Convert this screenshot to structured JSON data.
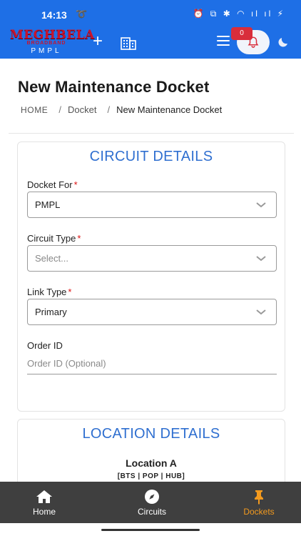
{
  "status_bar": {
    "time": "14:13",
    "indicators": "⏰ ⧉ ✱ ◠ ıl ıl ⚡"
  },
  "app_bar": {
    "logo_line1": "MEGHBELA",
    "logo_line2": "BROADBAND",
    "logo_line3": "PMPL",
    "notification_count": "0",
    "accent_color": "#1e6fe6"
  },
  "page": {
    "title": "New Maintenance Docket",
    "breadcrumb": {
      "home": "HOME",
      "separator": "/",
      "docket": "Docket",
      "current": "New Maintenance Docket"
    }
  },
  "circuit_details": {
    "title": "CIRCUIT DETAILS",
    "docket_for": {
      "label": "Docket For",
      "required_mark": "*",
      "value": "PMPL"
    },
    "circuit_type": {
      "label": "Circuit Type",
      "required_mark": "*",
      "value": "Select..."
    },
    "link_type": {
      "label": "Link Type",
      "required_mark": "*",
      "value": "Primary"
    },
    "order_id": {
      "label": "Order ID",
      "placeholder": "Order ID (Optional)"
    }
  },
  "location_details": {
    "title": "LOCATION DETAILS",
    "location_a": "Location A",
    "location_a_sub": "[BTS | POP | HUB]"
  },
  "bottom_nav": {
    "items": [
      {
        "label": "Home",
        "icon": "home-icon"
      },
      {
        "label": "Circuits",
        "icon": "compass-icon"
      },
      {
        "label": "Dockets",
        "icon": "pin-icon",
        "active": true
      }
    ],
    "active_color": "#f39a1e"
  }
}
